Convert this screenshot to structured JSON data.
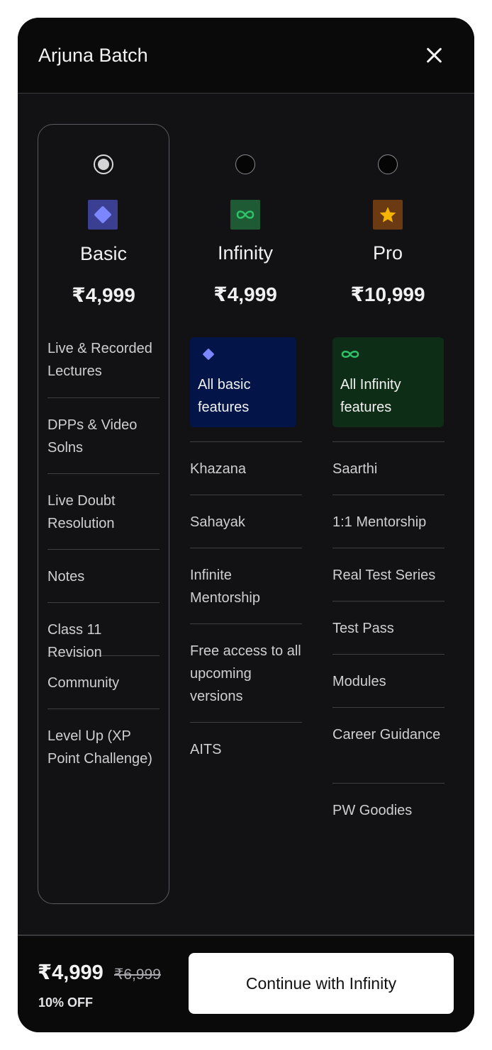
{
  "header": {
    "title": "Arjuna Batch",
    "close_icon": "close-icon"
  },
  "plans": [
    {
      "name": "Basic",
      "price": "₹4,999",
      "selected": true,
      "icon": "diamond-icon",
      "icon_bg": "#3a3f91",
      "icon_fg": "#7b86ff",
      "features": [
        "Live & Recorded Lectures",
        "DPPs & Video Solns",
        "Live Doubt Resolution",
        "Notes",
        "Class 11 Revision",
        "Community",
        "Level Up (XP Point Challenge)"
      ]
    },
    {
      "name": "Infinity",
      "price": "₹4,999",
      "selected": false,
      "icon": "infinity-icon",
      "icon_bg": "#1e5b34",
      "icon_fg": "#2fc26a",
      "card": {
        "text": "All basic features",
        "icon": "diamond-icon",
        "bg": "#031449"
      },
      "features": [
        "Khazana",
        "Sahayak",
        "Infinite Mentorship",
        "Free access to all upcoming versions",
        "AITS"
      ]
    },
    {
      "name": "Pro",
      "price": "₹10,999",
      "selected": false,
      "icon": "star-icon",
      "icon_bg": "#6b3a13",
      "icon_fg": "#f4b400",
      "card": {
        "text": "All Infinity features",
        "icon": "infinity-icon",
        "bg": "#0e2d17"
      },
      "features": [
        "Saarthi",
        "1:1 Mentorship",
        "Real Test Series",
        "Test Pass",
        "Modules",
        "Career Guidance",
        "PW Goodies"
      ]
    }
  ],
  "footer": {
    "final_price": "₹4,999",
    "original_price": "₹6,999",
    "discount": "10% OFF",
    "button_label": "Continue with Infinity"
  }
}
